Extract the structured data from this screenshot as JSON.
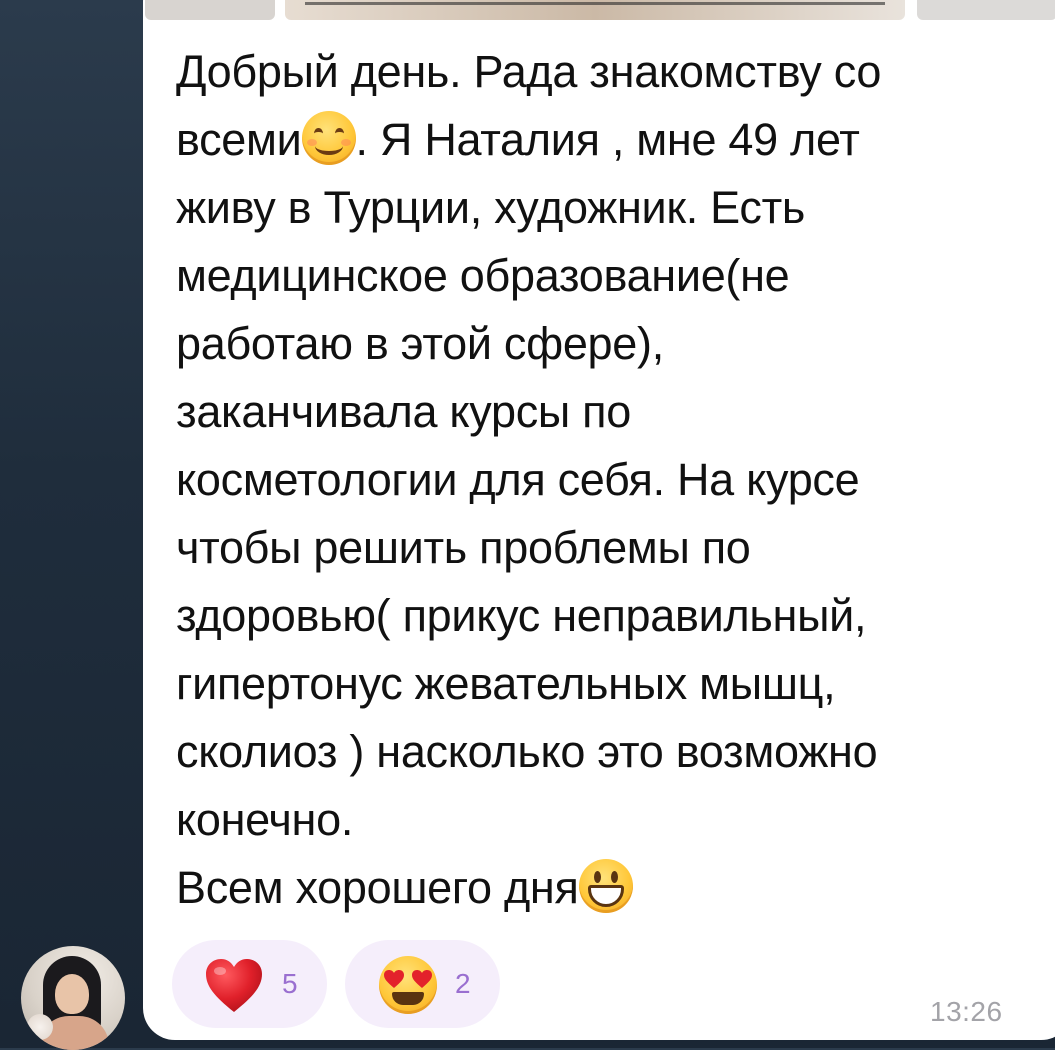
{
  "message": {
    "lines": [
      {
        "text": "Добрый день. Рада знакомству со"
      },
      {
        "before": "всеми",
        "emoji": "smiling-face-with-smiling-eyes",
        "after": ". Я Наталия , мне 49 лет"
      },
      {
        "text": "живу в Турции, художник. Есть"
      },
      {
        "text": "медицинское образование(не"
      },
      {
        "text": "работаю в этой сфере),"
      },
      {
        "text": "заканчивала курсы по"
      },
      {
        "text": "косметологии для себя. На курсе"
      },
      {
        "text": "чтобы решить проблемы по"
      },
      {
        "text": "здоровью( прикус неправильный,"
      },
      {
        "text": "гипертонус жевательных мышц,"
      },
      {
        "text": "сколиоз ) насколько это возможно"
      },
      {
        "text": "конечно."
      },
      {
        "before": "Всем хорошего дня",
        "emoji": "grinning-face"
      }
    ],
    "time": "13:26"
  },
  "reactions": [
    {
      "emoji": "red-heart",
      "count": "5"
    },
    {
      "emoji": "smiling-face-with-heart-eyes",
      "count": "2"
    }
  ],
  "colors": {
    "background": "#1f2d3c",
    "bubble": "#ffffff",
    "text": "#111111",
    "reaction_bg": "#f5eefb",
    "reaction_count": "#9a6fd0",
    "time": "#a3a3a8",
    "heart": "#e0202a"
  }
}
